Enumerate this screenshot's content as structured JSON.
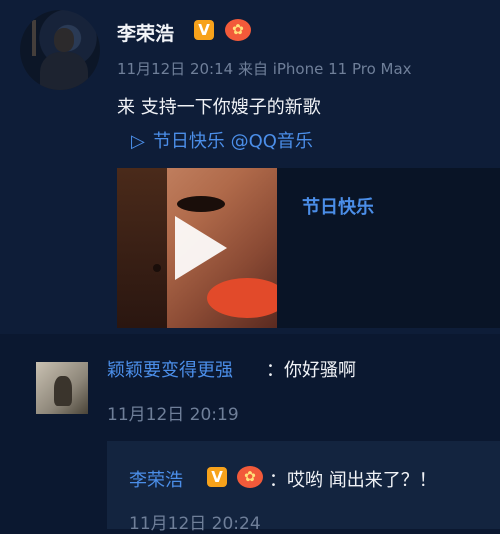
{
  "post": {
    "author": "李荣浩",
    "verified_badge": "V",
    "rank_badge": "✿",
    "meta": "11月12日 20:14 来自 iPhone 11 Pro Max",
    "content": "来 支持一下你嫂子的新歌",
    "link_text": "节日快乐 @QQ音乐",
    "link_icon": "play-outline-icon",
    "card": {
      "title": "节日快乐",
      "cover_icon": "play-icon"
    }
  },
  "comment": {
    "user": "颖颖要变得更强",
    "text": "：你好骚啊",
    "time": "11月12日 20:19",
    "reply": {
      "user": "李荣浩",
      "verified_badge": "V",
      "rank_badge": "✿",
      "text": "：哎哟 闻出来了？！",
      "time": "11月12日 20:24"
    }
  },
  "colors": {
    "link": "#4b8ee8",
    "background": "#0b1830",
    "verified": "#f7a21b",
    "rank": "#f25a3a"
  }
}
